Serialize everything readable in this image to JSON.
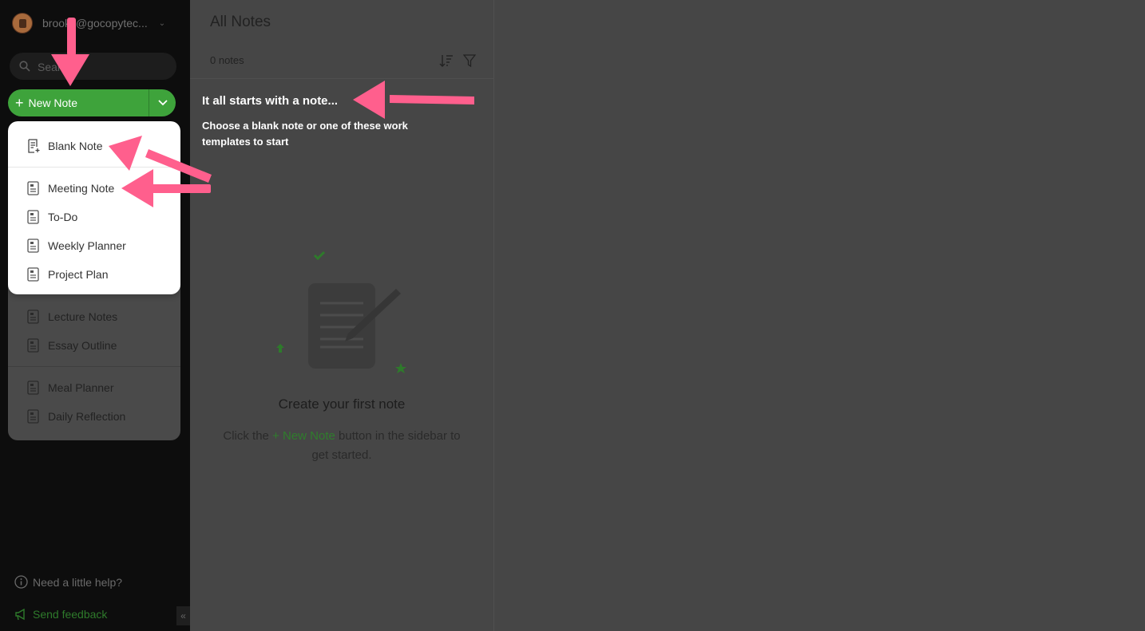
{
  "sidebar": {
    "account": {
      "name": "brooks@gocopytec..."
    },
    "search": {
      "placeholder": "Search"
    },
    "new_note": {
      "label": "New Note"
    },
    "help": {
      "label": "Need a little help?"
    },
    "feedback": {
      "label": "Send feedback"
    }
  },
  "template_menu": {
    "primary": {
      "label": "Blank Note",
      "icon": "blank-note-icon"
    },
    "top_items": [
      {
        "label": "Meeting Note",
        "icon": "template-icon"
      },
      {
        "label": "To-Do",
        "icon": "template-icon"
      },
      {
        "label": "Weekly Planner",
        "icon": "template-icon"
      },
      {
        "label": "Project Plan",
        "icon": "template-icon"
      }
    ],
    "lower_items": [
      {
        "label": "Lecture Notes",
        "icon": "template-icon"
      },
      {
        "label": "Essay Outline",
        "icon": "template-icon"
      },
      {
        "label": "Meal Planner",
        "icon": "template-icon"
      },
      {
        "label": "Daily Reflection",
        "icon": "template-icon"
      }
    ]
  },
  "notes_list": {
    "title": "All Notes",
    "count": "0 notes"
  },
  "empty_state": {
    "title": "Create your first note",
    "sub_before": "Click the",
    "sub_link": "+ New Note",
    "sub_after": "button in the sidebar to get started."
  },
  "tip": {
    "title": "It all starts with a note...",
    "body": "Choose a blank note or one of these work templates to start"
  },
  "colors": {
    "accent_green": "#3ea33b",
    "annotation_pink": "#ff5f8d"
  }
}
